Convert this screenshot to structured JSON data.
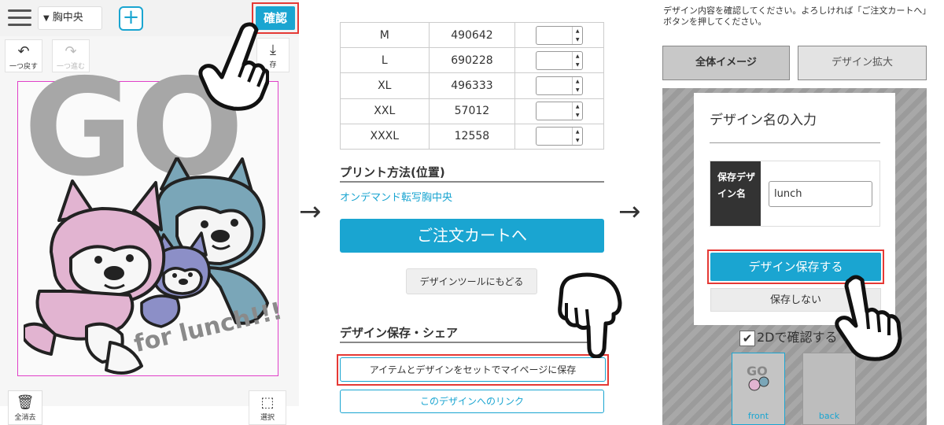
{
  "panel1": {
    "position_select": "胸中央",
    "confirm_label": "確認",
    "undo_label": "一つ戻す",
    "redo_label": "一つ進む",
    "save_label": "存",
    "delete_all_label": "全消去",
    "select_label": "選択",
    "design_text_main": "GO",
    "design_text_sub": "for lunch!!!"
  },
  "panel2": {
    "size_rows": [
      {
        "size": "M",
        "stock": "490642"
      },
      {
        "size": "L",
        "stock": "690228"
      },
      {
        "size": "XL",
        "stock": "496333"
      },
      {
        "size": "XXL",
        "stock": "57012"
      },
      {
        "size": "XXXL",
        "stock": "12558"
      }
    ],
    "print_section_title": "プリント方法(位置)",
    "print_method": "オンデマンド転写胸中央",
    "cart_button": "ご注文カートへ",
    "back_to_tool_button": "デザインツールにもどる",
    "save_share_title": "デザイン保存・シェア",
    "save_set_button": "アイテムとデザインをセットでマイページに保存",
    "design_link_button": "このデザインへのリンク"
  },
  "panel3": {
    "instruction": "デザイン内容を確認してください。よろしければ「ご注文カートへ」ボタンを押してください。",
    "tab_overall": "全体イメージ",
    "tab_zoom": "デザイン拡大",
    "modal_title": "デザイン名の入力",
    "name_label": "保存デザイン名",
    "name_value": "lunch",
    "save_design_button": "デザイン保存する",
    "dont_save_button": "保存しない",
    "check_2d_label": "2Dで確認する",
    "thumb_front": "front",
    "thumb_back": "back"
  },
  "colors": {
    "accent": "#1aa5d1",
    "highlight": "#e53935",
    "print_area_border": "#e040c8"
  }
}
